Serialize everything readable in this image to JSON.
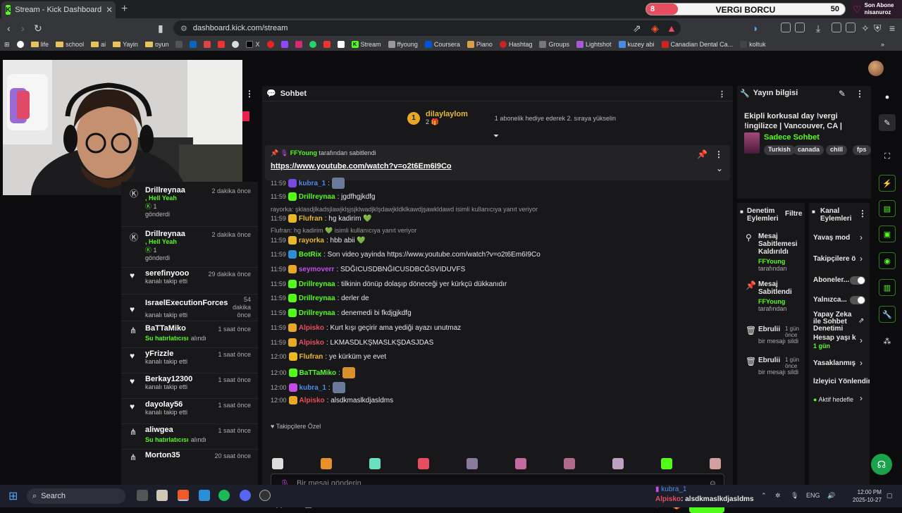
{
  "browser": {
    "tab_title": "Stream - Kick Dashboard",
    "tab_favicon_letter": "K",
    "url": "dashboard.kick.com/stream",
    "bookmarks": [
      "life",
      "school",
      "ai",
      "Yayin",
      "oyun",
      "X",
      "Stream",
      "ffyoung",
      "Coursera",
      "Piano",
      "Hashtag",
      "Groups",
      "Lightshot",
      "kuzey abi",
      "Canadian Dental Ca...",
      "koltuk"
    ]
  },
  "overlay": {
    "goal_current": "8",
    "goal_label": "VERGI BORCU",
    "goal_target": "50",
    "goal_progress": 0.16,
    "last_sub_line1": "Son Abone",
    "last_sub_line2": "nisanuroz"
  },
  "activity": [
    {
      "name": "Drillreynaa",
      "line2": ", Hell Yeah",
      "count": "1",
      "action": "gönderdi",
      "time": "2 dakika önce",
      "icon": "kick"
    },
    {
      "name": "Drillreynaa",
      "line2": ", Hell Yeah",
      "count": "1",
      "action": "gönderdi",
      "time": "2 dakika önce",
      "icon": "kick"
    },
    {
      "name": "serefinyooo",
      "line2": "",
      "action": "kanalı takip etti",
      "time": "29 dakika önce",
      "icon": "heart"
    },
    {
      "name": "IsraelExecutionForces",
      "line2": "",
      "action": "kanalı takip etti",
      "time": "54 dakika önce",
      "icon": "heart"
    },
    {
      "name": "BaTTaMiko",
      "line2": "Su hatırlatıcısı",
      "action": "alındı",
      "time": "1 saat önce",
      "icon": "share"
    },
    {
      "name": "yFrizzle",
      "line2": "",
      "action": "kanalı takip etti",
      "time": "1 saat önce",
      "icon": "heart"
    },
    {
      "name": "Berkay12300",
      "line2": "",
      "action": "kanalı takip etti",
      "time": "1 saat önce",
      "icon": "heart"
    },
    {
      "name": "dayolay56",
      "line2": "",
      "action": "kanalı takip etti",
      "time": "1 saat önce",
      "icon": "heart"
    },
    {
      "name": "aliwgea",
      "line2": "Su hatırlatıcısı",
      "action": "alındı",
      "time": "1 saat önce",
      "icon": "share"
    },
    {
      "name": "Morton35",
      "line2": "",
      "action": "",
      "time": "20 saat önce",
      "icon": "share"
    }
  ],
  "chat": {
    "title": "Sohbet",
    "top_gifter": "dilaylaylom",
    "top_gifter_rank": "1",
    "top_gifter_count": "2",
    "gift_note": "1 abonelik hediye ederek 2. sıraya yükselin",
    "pinned_by_user": "FFYoung",
    "pinned_by_suffix": "tarafından sabitlendi",
    "pinned_link": "https://www.youtube.com/watch?v=o2t6Em6I9Co",
    "messages": [
      {
        "time": "11:59",
        "user": "kubra_1",
        "color": "#4a8cf0",
        "text": ":"
      },
      {
        "time": "11:59",
        "user": "Drillreynaa",
        "color": "#53fc18",
        "text": ": jgdfhgjkdfg"
      },
      {
        "time": "11:59",
        "user": "Flufran",
        "color": "#e8b825",
        "text": ": hg kadirim 💚",
        "reply": "rayorka: şklasdjlkadsjlawjklşjsjklwadjklşdawjkldklkawdjşawkldawd isimli kullanıcıya yanıt veriyor"
      },
      {
        "time": "11:59",
        "user": "rayorka",
        "color": "#e8b825",
        "text": ": hbb abii 💚",
        "reply": "Flufran: hg kadirim 💚 isimli kullanıcıya yanıt veriyor"
      },
      {
        "time": "11:59",
        "user": "BotRix",
        "color": "#53fc18",
        "text": ": Son video yayinda https://www.youtube.com/watch?v=o2t6Em6I9Co"
      },
      {
        "time": "11:59",
        "user": "seymoverr",
        "color": "#c44de8",
        "text": ": SDĞICUSDBNĞICUSDBCĞSVIDUVFS"
      },
      {
        "time": "11:59",
        "user": "Drillreynaa",
        "color": "#53fc18",
        "text": ": tilkinin dönüp dolaşıp döneceği yer kürkçü dükkanıdır"
      },
      {
        "time": "11:59",
        "user": "Drillreynaa",
        "color": "#53fc18",
        "text": ": derler de"
      },
      {
        "time": "11:59",
        "user": "Drillreynaa",
        "color": "#53fc18",
        "text": ": denemedi bi fkdjgjkdfg"
      },
      {
        "time": "11:59",
        "user": "Alpisko",
        "color": "#e84c5f",
        "text": ": Kurt kışı geçirir ama yediği ayazı unutmaz"
      },
      {
        "time": "11:59",
        "user": "Alpisko",
        "color": "#e84c5f",
        "text": ": LKMASDLKŞMASLKŞDASJDAS"
      },
      {
        "time": "12:00",
        "user": "Flufran",
        "color": "#e8b825",
        "text": ": ye kürküm ye evet"
      },
      {
        "time": "12:00",
        "user": "BaTTaMiko",
        "color": "#53fc18",
        "text": ":"
      },
      {
        "time": "12:00",
        "user": "kubra_1",
        "color": "#4a8cf0",
        "text": ":"
      },
      {
        "time": "12:00",
        "user": "Alpisko",
        "color": "#e84c5f",
        "text": ": alsdkmaslkdjasldms"
      }
    ],
    "emote_section": "Takipçilere Özel",
    "input_placeholder": "Bir mesaj gönderin",
    "send_label": "Gönder"
  },
  "stream_info": {
    "header": "Yayın bilgisi",
    "title": "Ekipli korkusal day !vergi !ingilizce | Vancouver, CA |",
    "category": "Sadece Sohbet",
    "tags": [
      "Turkish",
      "canada",
      "chill",
      "fps"
    ]
  },
  "mod_actions": {
    "header": "Denetim Eylemleri",
    "filter": "Filtre",
    "items": [
      {
        "title": "Mesaj Sabitlemesi Kaldırıldı",
        "by": "FFYoung",
        "suffix": "tarafından",
        "time": "",
        "icon": "pin-off"
      },
      {
        "title": "Mesaj Sabitlendi",
        "by": "FFYoung",
        "suffix": "tarafından",
        "time": "",
        "icon": "pin"
      },
      {
        "title": "Ebrulii",
        "by": "",
        "suffix": "bir mesajı sildi",
        "time": "1 gün önce",
        "icon": "trash"
      },
      {
        "title": "Ebrulii",
        "by": "",
        "suffix": "bir mesajı sildi",
        "time": "1 gün önce",
        "icon": "trash"
      }
    ]
  },
  "channel_actions": {
    "header": "Kanal Eylemleri",
    "items": [
      {
        "label": "Yavaş mod",
        "kind": "arrow"
      },
      {
        "label": "Takipçilere ö",
        "kind": "arrow"
      },
      {
        "label": "Aboneler...",
        "kind": "toggle"
      },
      {
        "label": "Yalnızca...",
        "kind": "toggle"
      },
      {
        "label": "Yapay Zeka ile Sohbet Denetimi",
        "kind": "link"
      },
      {
        "label": "Hesap yaşı k",
        "kind": "arrow",
        "sub": "1 gün"
      },
      {
        "label": "Yasaklanmış",
        "kind": "arrow"
      },
      {
        "label": "İzleyici Yönlendir",
        "kind": "none"
      },
      {
        "label": "Aktif hedefle",
        "kind": "arrow"
      }
    ]
  },
  "taskbar": {
    "search": "Search",
    "notif_user": "kubra_1",
    "notif_user2": "Alpisko",
    "notif_text": ": alsdkmaslkdjasldms",
    "lang": "ENG",
    "time": "12:00 PM",
    "date": "2025-10-27"
  }
}
